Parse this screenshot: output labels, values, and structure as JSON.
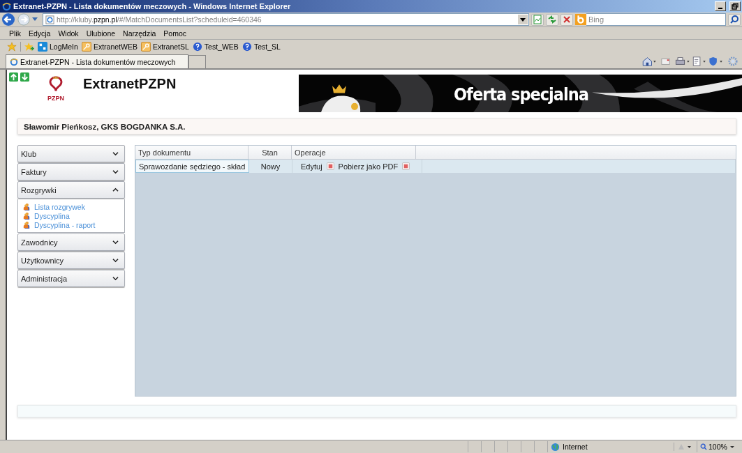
{
  "window": {
    "title": "Extranet-PZPN - Lista dokumentów meczowych - Windows Internet Explorer"
  },
  "address_bar": {
    "url_prefix": "http://kluby.",
    "url_domain": "pzpn.pl",
    "url_rest": "/#/MatchDocumentsList?scheduleid=460346"
  },
  "search": {
    "placeholder": "Bing"
  },
  "menu": [
    "Plik",
    "Edycja",
    "Widok",
    "Ulubione",
    "Narzędzia",
    "Pomoc"
  ],
  "favorites": [
    {
      "label": "LogMeIn",
      "kind": "logmein"
    },
    {
      "label": "ExtranetWEB",
      "kind": "key"
    },
    {
      "label": "ExtranetSL",
      "kind": "key"
    },
    {
      "label": "Test_WEB",
      "kind": "help"
    },
    {
      "label": "Test_SL",
      "kind": "help"
    }
  ],
  "tab": {
    "label": "Extranet-PZPN - Lista dokumentów meczowych"
  },
  "page": {
    "logo_text": "PZPN",
    "site_title": "ExtranetPZPN",
    "banner_headline": "Oferta specjalna",
    "user_line": "Sławomir Pieńkosz, GKS BOGDANKA S.A."
  },
  "sidebar": {
    "sections": [
      {
        "label": "Klub",
        "expanded": false
      },
      {
        "label": "Faktury",
        "expanded": false
      },
      {
        "label": "Rozgrywki",
        "expanded": true,
        "items": [
          "Lista rozgrywek",
          "Dyscyplina",
          "Dyscyplina - raport"
        ]
      },
      {
        "label": "Zawodnicy",
        "expanded": false
      },
      {
        "label": "Użytkownicy",
        "expanded": false
      },
      {
        "label": "Administracja",
        "expanded": false
      }
    ]
  },
  "table": {
    "columns": [
      "Typ dokumentu",
      "Stan",
      "Operacje"
    ],
    "rows": [
      {
        "type": "Sprawozdanie sędziego - skład",
        "status": "Nowy",
        "edit": "Edytuj",
        "download": "Pobierz jako PDF",
        "selected": true
      }
    ]
  },
  "status_bar": {
    "zone": "Internet",
    "zoom": "100%"
  }
}
